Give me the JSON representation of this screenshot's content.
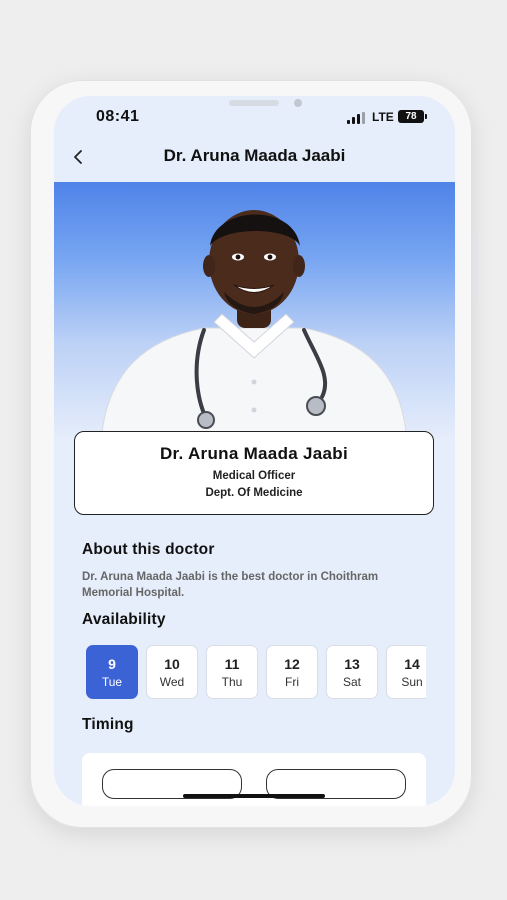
{
  "status_bar": {
    "time": "08:41",
    "network": "LTE",
    "battery": "78"
  },
  "nav": {
    "title": "Dr. Aruna Maada Jaabi"
  },
  "profile": {
    "name": "Dr. Aruna Maada Jaabi",
    "role": "Medical Officer",
    "department": "Dept. Of Medicine"
  },
  "about": {
    "title": "About this doctor",
    "text": "Dr. Aruna Maada Jaabi is the best doctor in Choithram Memorial Hospital."
  },
  "availability": {
    "title": "Availability",
    "days": [
      {
        "num": "9",
        "day": "Tue",
        "selected": true
      },
      {
        "num": "10",
        "day": "Wed",
        "selected": false
      },
      {
        "num": "11",
        "day": "Thu",
        "selected": false
      },
      {
        "num": "12",
        "day": "Fri",
        "selected": false
      },
      {
        "num": "13",
        "day": "Sat",
        "selected": false
      },
      {
        "num": "14",
        "day": "Sun",
        "selected": false
      }
    ]
  },
  "timing": {
    "title": "Timing"
  },
  "colors": {
    "accent": "#3b63d6",
    "screen_bg": "#e7eefb"
  },
  "icons": {
    "back": "chevron-left-icon"
  }
}
